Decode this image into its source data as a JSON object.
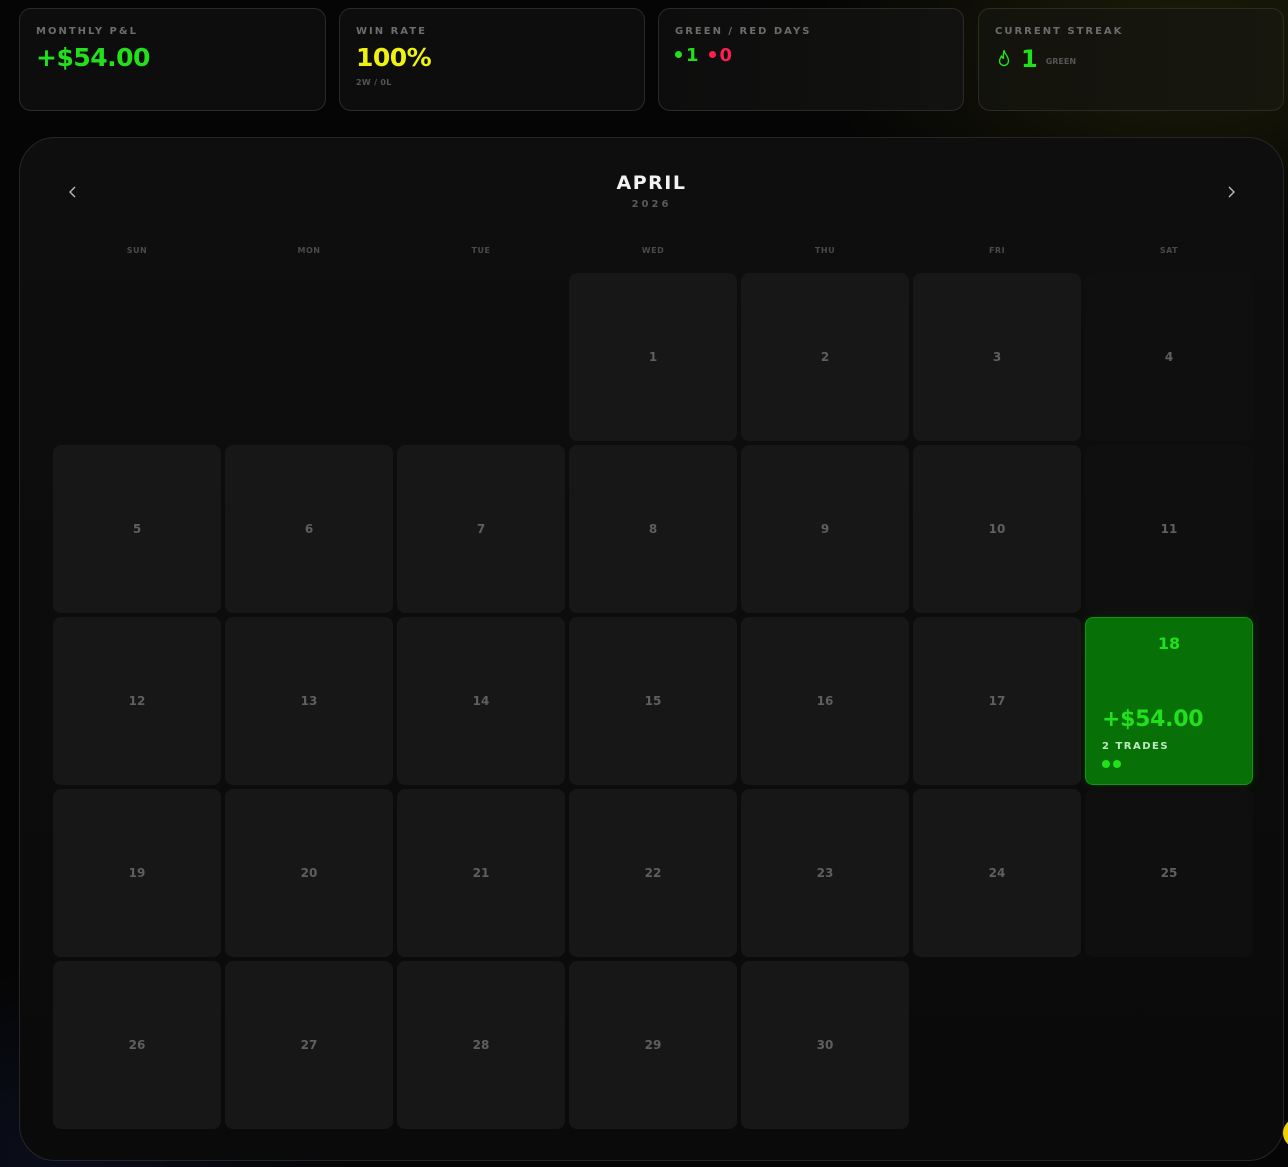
{
  "colors": {
    "green": "#22e01c",
    "yellow": "#eef212",
    "red": "#ff1f4f",
    "active_cell_bg": "#077107"
  },
  "stats": {
    "monthly_pnl": {
      "label": "MONTHLY P&L",
      "value": "+$54.00"
    },
    "win_rate": {
      "label": "WIN RATE",
      "value": "100%",
      "sub": "2W / 0L"
    },
    "green_red_days": {
      "label": "GREEN / RED DAYS",
      "green": "1",
      "red": "0"
    },
    "current_streak": {
      "label": "CURRENT STREAK",
      "icon": "flame-icon",
      "value": "1",
      "tag": "GREEN"
    }
  },
  "calendar": {
    "month": "APRIL",
    "year": "2026",
    "prev_icon": "chevron-left-icon",
    "next_icon": "chevron-right-icon",
    "weekdays": [
      "SUN",
      "MON",
      "TUE",
      "WED",
      "THU",
      "FRI",
      "SAT"
    ],
    "leading_blanks": 3,
    "days_in_month": 30,
    "active_day": {
      "day": "18",
      "pnl": "+$54.00",
      "trades": "2 TRADES",
      "trade_dots": 2
    }
  }
}
